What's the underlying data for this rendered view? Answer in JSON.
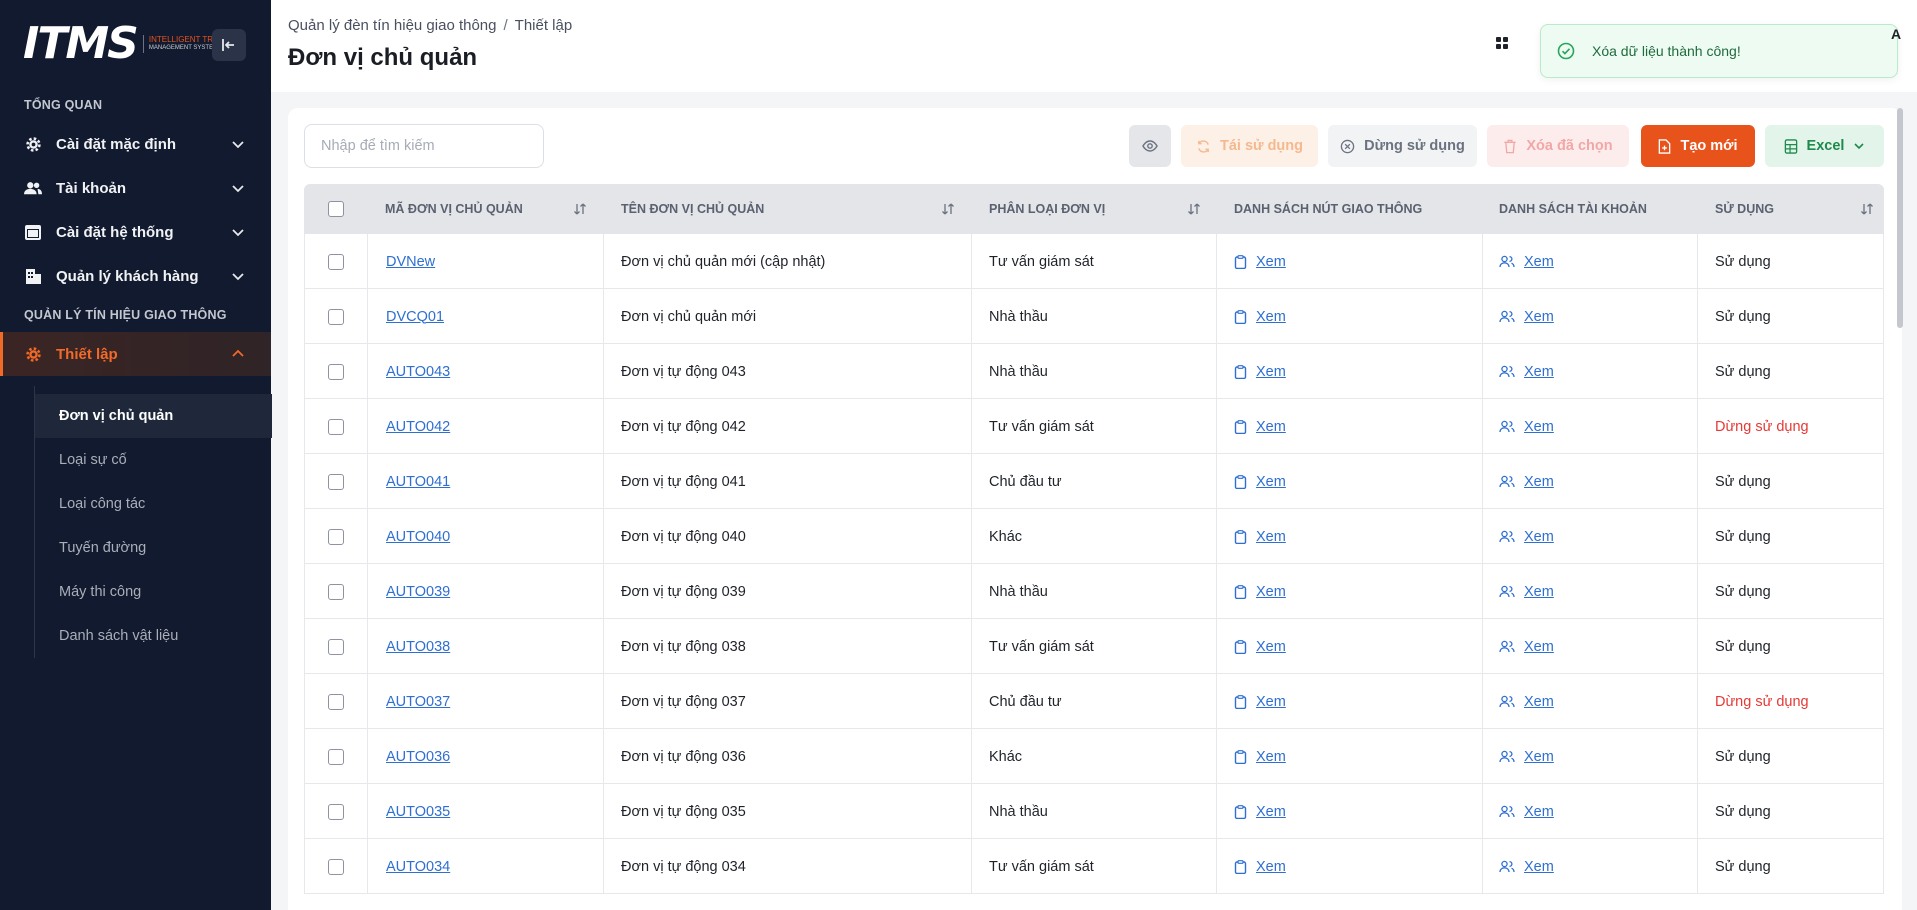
{
  "sidebar": {
    "logo": {
      "mark": "ITMS",
      "tag_line1": "INTELLIGENT TRAFFIC",
      "tag_line2": "MANAGEMENT SYSTEM"
    },
    "section_overview": "TỔNG QUAN",
    "section_signals": "QUẢN LÝ TÍN HIỆU GIAO THÔNG",
    "items": [
      {
        "label": "Cài đặt mặc định",
        "icon": "gear-icon"
      },
      {
        "label": "Tài khoản",
        "icon": "users-icon"
      },
      {
        "label": "Cài đặt hệ thống",
        "icon": "window-icon"
      },
      {
        "label": "Quản lý khách hàng",
        "icon": "building-icon"
      },
      {
        "label": "Thiết lập",
        "icon": "gear-icon"
      }
    ],
    "sub_items": [
      {
        "label": "Đơn vị chủ quản"
      },
      {
        "label": "Loại sự cố"
      },
      {
        "label": "Loại công tác"
      },
      {
        "label": "Tuyến đường"
      },
      {
        "label": "Máy thi công"
      },
      {
        "label": "Danh sách vật liệu"
      }
    ]
  },
  "header": {
    "breadcrumb": [
      "Quản lý đèn tín hiệu giao thông",
      "Thiết lập"
    ],
    "title": "Đơn vị chủ quản",
    "user_initial": "A"
  },
  "toast": {
    "message": "Xóa dữ liệu thành công!"
  },
  "toolbar": {
    "search_placeholder": "Nhập để tìm kiếm",
    "reuse_label": "Tái sử dụng",
    "stop_label": "Dừng sử dụng",
    "delete_selected_label": "Xóa đã chọn",
    "create_label": "Tạo mới",
    "excel_label": "Excel"
  },
  "table": {
    "headers": {
      "code": "MÃ ĐƠN VỊ CHỦ QUẢN",
      "name": "TÊN ĐƠN VỊ CHỦ QUẢN",
      "type": "PHÂN LOẠI ĐƠN VỊ",
      "nodes": "DANH SÁCH NÚT GIAO THÔNG",
      "accounts": "DANH SÁCH TÀI KHOẢN",
      "status": "SỬ DỤNG"
    },
    "view_label": "Xem",
    "rows": [
      {
        "code": "DVNew",
        "name": "Đơn vị chủ quản mới (cập nhật)",
        "type": "Tư vấn giám sát",
        "status": "Sử dụng",
        "active": true
      },
      {
        "code": "DVCQ01",
        "name": "Đơn vị chủ quản mới",
        "type": "Nhà thầu",
        "status": "Sử dụng",
        "active": true
      },
      {
        "code": "AUTO043",
        "name": "Đơn vị tự động 043",
        "type": "Nhà thầu",
        "status": "Sử dụng",
        "active": true
      },
      {
        "code": "AUTO042",
        "name": "Đơn vị tự động 042",
        "type": "Tư vấn giám sát",
        "status": "Dừng sử dụng",
        "active": false
      },
      {
        "code": "AUTO041",
        "name": "Đơn vị tự động 041",
        "type": "Chủ đầu tư",
        "status": "Sử dụng",
        "active": true
      },
      {
        "code": "AUTO040",
        "name": "Đơn vị tự động 040",
        "type": "Khác",
        "status": "Sử dụng",
        "active": true
      },
      {
        "code": "AUTO039",
        "name": "Đơn vị tự động 039",
        "type": "Nhà thầu",
        "status": "Sử dụng",
        "active": true
      },
      {
        "code": "AUTO038",
        "name": "Đơn vị tự động 038",
        "type": "Tư vấn giám sát",
        "status": "Sử dụng",
        "active": true
      },
      {
        "code": "AUTO037",
        "name": "Đơn vị tự động 037",
        "type": "Chủ đầu tư",
        "status": "Dừng sử dụng",
        "active": false
      },
      {
        "code": "AUTO036",
        "name": "Đơn vị tự động 036",
        "type": "Khác",
        "status": "Sử dụng",
        "active": true
      },
      {
        "code": "AUTO035",
        "name": "Đơn vị tự động 035",
        "type": "Nhà thầu",
        "status": "Sử dụng",
        "active": true
      },
      {
        "code": "AUTO034",
        "name": "Đơn vị tự động 034",
        "type": "Tư vấn giám sát",
        "status": "Sử dụng",
        "active": true
      }
    ]
  },
  "colors": {
    "accent": "#e8531c",
    "sidebar_bg": "#111a2e",
    "link": "#2e6fd1",
    "danger": "#e53935",
    "success": "#1e8a4c"
  }
}
